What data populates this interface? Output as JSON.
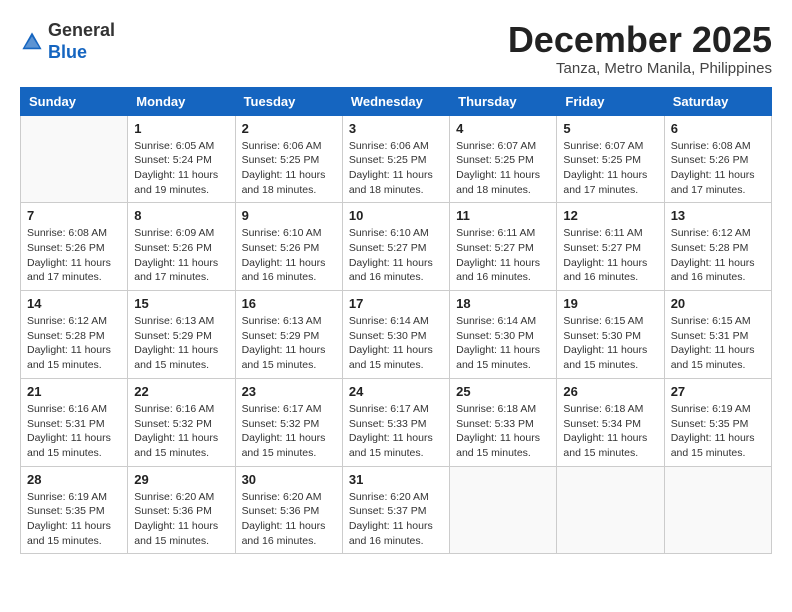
{
  "header": {
    "logo_general": "General",
    "logo_blue": "Blue",
    "month_title": "December 2025",
    "location": "Tanza, Metro Manila, Philippines"
  },
  "calendar": {
    "days_of_week": [
      "Sunday",
      "Monday",
      "Tuesday",
      "Wednesday",
      "Thursday",
      "Friday",
      "Saturday"
    ],
    "weeks": [
      [
        {
          "day": "",
          "info": ""
        },
        {
          "day": "1",
          "info": "Sunrise: 6:05 AM\nSunset: 5:24 PM\nDaylight: 11 hours\nand 19 minutes."
        },
        {
          "day": "2",
          "info": "Sunrise: 6:06 AM\nSunset: 5:25 PM\nDaylight: 11 hours\nand 18 minutes."
        },
        {
          "day": "3",
          "info": "Sunrise: 6:06 AM\nSunset: 5:25 PM\nDaylight: 11 hours\nand 18 minutes."
        },
        {
          "day": "4",
          "info": "Sunrise: 6:07 AM\nSunset: 5:25 PM\nDaylight: 11 hours\nand 18 minutes."
        },
        {
          "day": "5",
          "info": "Sunrise: 6:07 AM\nSunset: 5:25 PM\nDaylight: 11 hours\nand 17 minutes."
        },
        {
          "day": "6",
          "info": "Sunrise: 6:08 AM\nSunset: 5:26 PM\nDaylight: 11 hours\nand 17 minutes."
        }
      ],
      [
        {
          "day": "7",
          "info": "Sunrise: 6:08 AM\nSunset: 5:26 PM\nDaylight: 11 hours\nand 17 minutes."
        },
        {
          "day": "8",
          "info": "Sunrise: 6:09 AM\nSunset: 5:26 PM\nDaylight: 11 hours\nand 17 minutes."
        },
        {
          "day": "9",
          "info": "Sunrise: 6:10 AM\nSunset: 5:26 PM\nDaylight: 11 hours\nand 16 minutes."
        },
        {
          "day": "10",
          "info": "Sunrise: 6:10 AM\nSunset: 5:27 PM\nDaylight: 11 hours\nand 16 minutes."
        },
        {
          "day": "11",
          "info": "Sunrise: 6:11 AM\nSunset: 5:27 PM\nDaylight: 11 hours\nand 16 minutes."
        },
        {
          "day": "12",
          "info": "Sunrise: 6:11 AM\nSunset: 5:27 PM\nDaylight: 11 hours\nand 16 minutes."
        },
        {
          "day": "13",
          "info": "Sunrise: 6:12 AM\nSunset: 5:28 PM\nDaylight: 11 hours\nand 16 minutes."
        }
      ],
      [
        {
          "day": "14",
          "info": "Sunrise: 6:12 AM\nSunset: 5:28 PM\nDaylight: 11 hours\nand 15 minutes."
        },
        {
          "day": "15",
          "info": "Sunrise: 6:13 AM\nSunset: 5:29 PM\nDaylight: 11 hours\nand 15 minutes."
        },
        {
          "day": "16",
          "info": "Sunrise: 6:13 AM\nSunset: 5:29 PM\nDaylight: 11 hours\nand 15 minutes."
        },
        {
          "day": "17",
          "info": "Sunrise: 6:14 AM\nSunset: 5:30 PM\nDaylight: 11 hours\nand 15 minutes."
        },
        {
          "day": "18",
          "info": "Sunrise: 6:14 AM\nSunset: 5:30 PM\nDaylight: 11 hours\nand 15 minutes."
        },
        {
          "day": "19",
          "info": "Sunrise: 6:15 AM\nSunset: 5:30 PM\nDaylight: 11 hours\nand 15 minutes."
        },
        {
          "day": "20",
          "info": "Sunrise: 6:15 AM\nSunset: 5:31 PM\nDaylight: 11 hours\nand 15 minutes."
        }
      ],
      [
        {
          "day": "21",
          "info": "Sunrise: 6:16 AM\nSunset: 5:31 PM\nDaylight: 11 hours\nand 15 minutes."
        },
        {
          "day": "22",
          "info": "Sunrise: 6:16 AM\nSunset: 5:32 PM\nDaylight: 11 hours\nand 15 minutes."
        },
        {
          "day": "23",
          "info": "Sunrise: 6:17 AM\nSunset: 5:32 PM\nDaylight: 11 hours\nand 15 minutes."
        },
        {
          "day": "24",
          "info": "Sunrise: 6:17 AM\nSunset: 5:33 PM\nDaylight: 11 hours\nand 15 minutes."
        },
        {
          "day": "25",
          "info": "Sunrise: 6:18 AM\nSunset: 5:33 PM\nDaylight: 11 hours\nand 15 minutes."
        },
        {
          "day": "26",
          "info": "Sunrise: 6:18 AM\nSunset: 5:34 PM\nDaylight: 11 hours\nand 15 minutes."
        },
        {
          "day": "27",
          "info": "Sunrise: 6:19 AM\nSunset: 5:35 PM\nDaylight: 11 hours\nand 15 minutes."
        }
      ],
      [
        {
          "day": "28",
          "info": "Sunrise: 6:19 AM\nSunset: 5:35 PM\nDaylight: 11 hours\nand 15 minutes."
        },
        {
          "day": "29",
          "info": "Sunrise: 6:20 AM\nSunset: 5:36 PM\nDaylight: 11 hours\nand 15 minutes."
        },
        {
          "day": "30",
          "info": "Sunrise: 6:20 AM\nSunset: 5:36 PM\nDaylight: 11 hours\nand 16 minutes."
        },
        {
          "day": "31",
          "info": "Sunrise: 6:20 AM\nSunset: 5:37 PM\nDaylight: 11 hours\nand 16 minutes."
        },
        {
          "day": "",
          "info": ""
        },
        {
          "day": "",
          "info": ""
        },
        {
          "day": "",
          "info": ""
        }
      ]
    ]
  }
}
